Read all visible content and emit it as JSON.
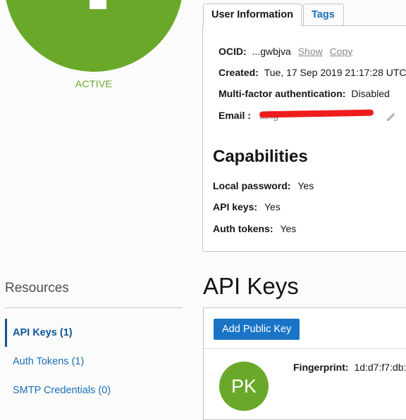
{
  "profile": {
    "status": "ACTIVE"
  },
  "tabs": [
    {
      "label": "User Information",
      "active": true
    },
    {
      "label": "Tags",
      "active": false
    }
  ],
  "user_info": {
    "ocid_label": "OCID:",
    "ocid_value": "...gwbjva",
    "show_link": "Show",
    "copy_link": "Copy",
    "created_label": "Created:",
    "created_value": "Tue, 17 Sep 2019 21:17:28 UTC",
    "mfa_label": "Multi-factor authentication:",
    "mfa_value": "Disabled",
    "email_label": "Email :",
    "email_value": "tang",
    "edit_icon": "pencil-icon"
  },
  "capabilities": {
    "title": "Capabilities",
    "items": [
      {
        "label": "Local password:",
        "value": "Yes"
      },
      {
        "label": "API keys:",
        "value": "Yes"
      },
      {
        "label": "Auth tokens:",
        "value": "Yes"
      }
    ]
  },
  "resources": {
    "title": "Resources",
    "items": [
      {
        "label": "API Keys (1)",
        "active": true
      },
      {
        "label": "Auth Tokens (1)",
        "active": false
      },
      {
        "label": "SMTP Credentials (0)",
        "active": false
      }
    ]
  },
  "api_keys": {
    "title": "API Keys",
    "add_button": "Add Public Key",
    "keys": [
      {
        "avatar": "PK",
        "fingerprint_label": "Fingerprint:",
        "fingerprint_value": "1d:d7:f7:db:"
      }
    ]
  },
  "colors": {
    "active_green": "#6aa82a",
    "link_blue": "#1a6fb8",
    "button_blue": "#1a74c6",
    "redaction_red": "#ee1c1c"
  }
}
